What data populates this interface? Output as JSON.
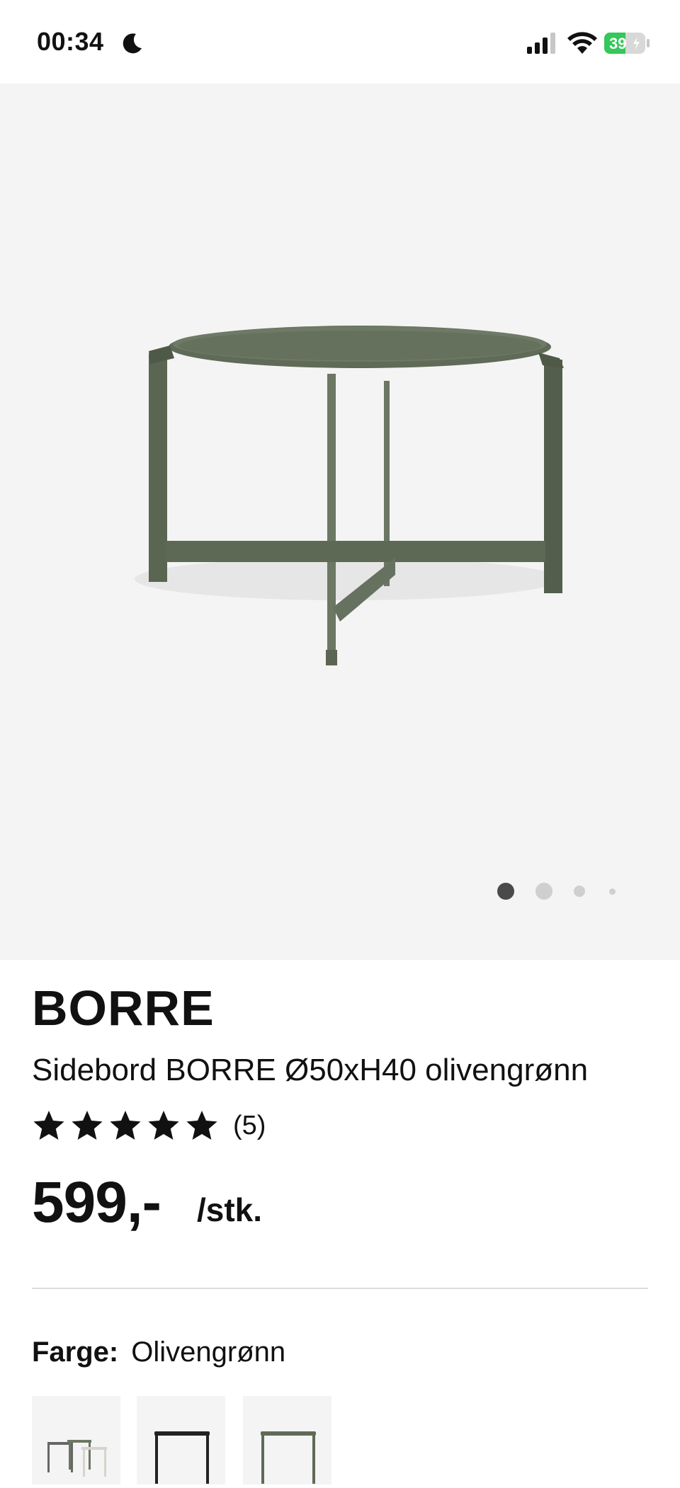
{
  "status": {
    "time": "00:34",
    "battery": "39"
  },
  "gallery": {
    "image_alt": "Sidebord BORRE",
    "dots": 4,
    "active_index": 0
  },
  "product": {
    "brand": "BORRE",
    "description": "Sidebord BORRE Ø50xH40 olivengrønn",
    "rating": {
      "stars": 5,
      "count_label": "(5)"
    },
    "price": "599,-",
    "unit": "/stk."
  },
  "color": {
    "label": "Farge:",
    "value": "Olivengrønn",
    "swatches": [
      "Sidebord sett",
      "Sidebord svart",
      "Sidebord olivengrønn"
    ]
  },
  "colors": {
    "table": "#5f6a57",
    "hero_bg": "#f4f4f4",
    "battery_green": "#34c759"
  }
}
